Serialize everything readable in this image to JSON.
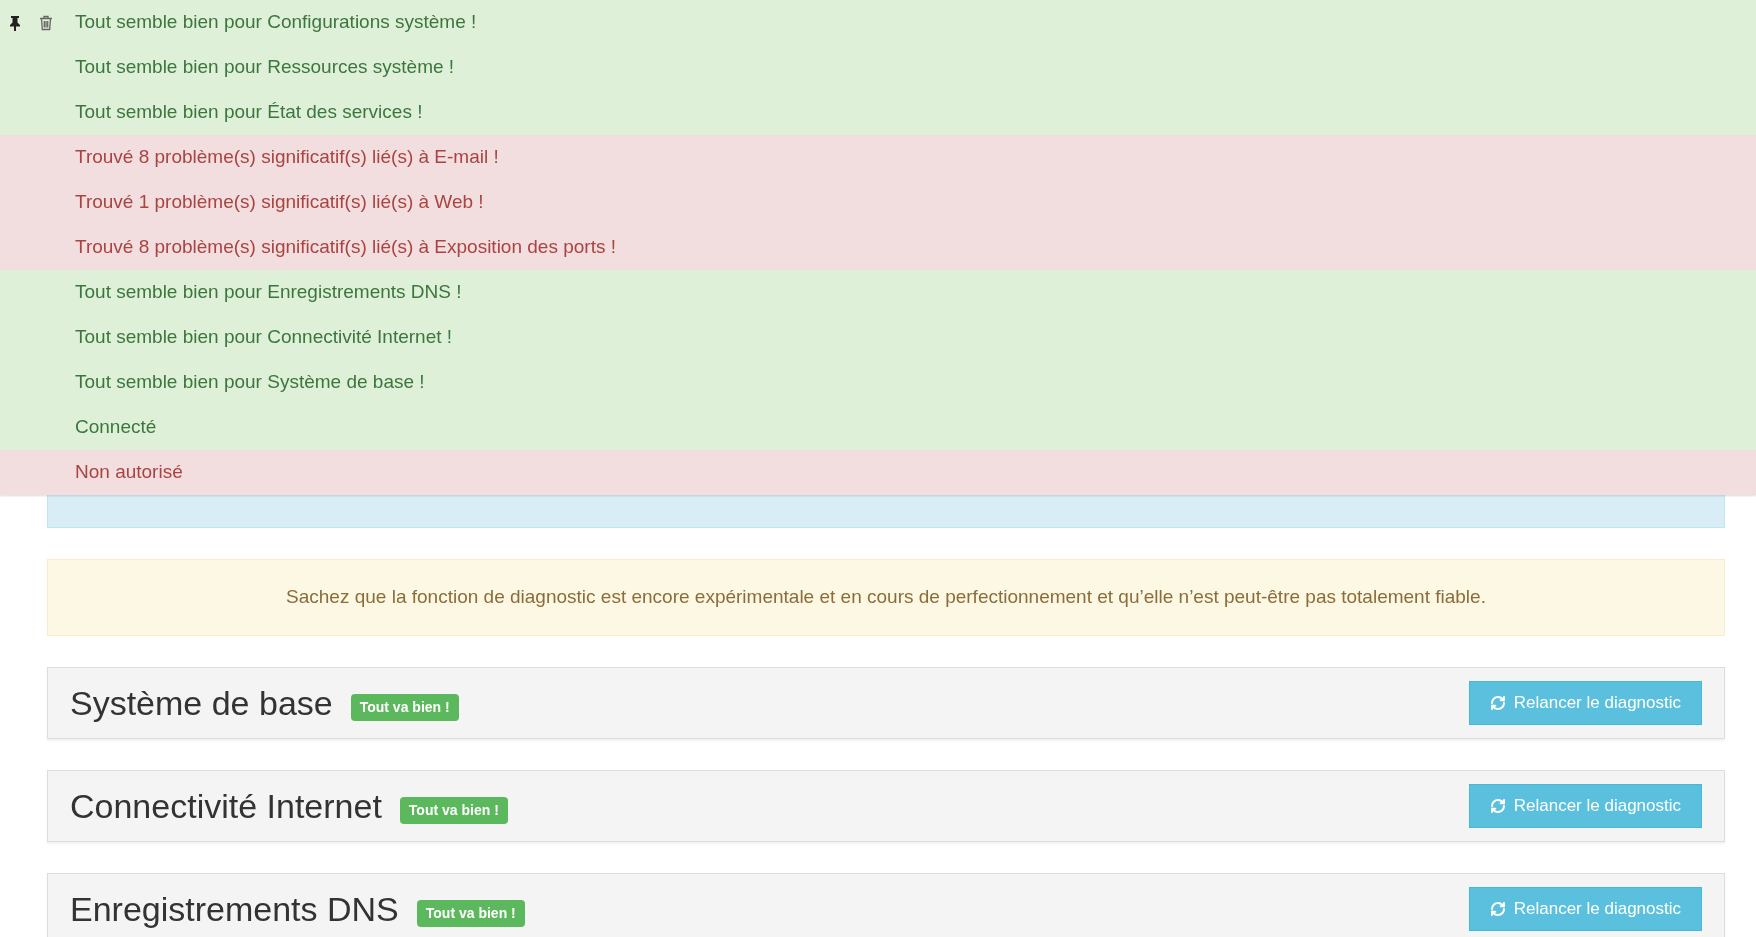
{
  "notifications": [
    {
      "text": "Tout semble bien pour Configurations système !",
      "kind": "success"
    },
    {
      "text": "Tout semble bien pour Ressources système !",
      "kind": "success"
    },
    {
      "text": "Tout semble bien pour État des services !",
      "kind": "success"
    },
    {
      "text": "Trouvé 8 problème(s) significatif(s) lié(s) à E-mail !",
      "kind": "danger"
    },
    {
      "text": "Trouvé 1 problème(s) significatif(s) lié(s) à Web !",
      "kind": "danger"
    },
    {
      "text": "Trouvé 8 problème(s) significatif(s) lié(s) à Exposition des ports !",
      "kind": "danger"
    },
    {
      "text": "Tout semble bien pour Enregistrements DNS !",
      "kind": "success"
    },
    {
      "text": "Tout semble bien pour Connectivité Internet !",
      "kind": "success"
    },
    {
      "text": "Tout semble bien pour Système de base !",
      "kind": "success"
    },
    {
      "text": "Connecté",
      "kind": "success"
    },
    {
      "text": "Non autorisé",
      "kind": "danger"
    }
  ],
  "warning_alert": {
    "text": "Sachez que la fonction de diagnostic est encore expérimentale et en cours de perfectionnement et qu’elle n’est peut-être pas totalement fiable."
  },
  "sections": [
    {
      "title": "Système de base",
      "badge": {
        "text": "Tout va bien !",
        "kind": "success"
      },
      "button": "Relancer le diagnostic"
    },
    {
      "title": "Connectivité Internet",
      "badge": {
        "text": "Tout va bien !",
        "kind": "success"
      },
      "button": "Relancer le diagnostic"
    },
    {
      "title": "Enregistrements DNS",
      "badge": {
        "text": "Tout va bien !",
        "kind": "success"
      },
      "button": "Relancer le diagnostic"
    }
  ]
}
